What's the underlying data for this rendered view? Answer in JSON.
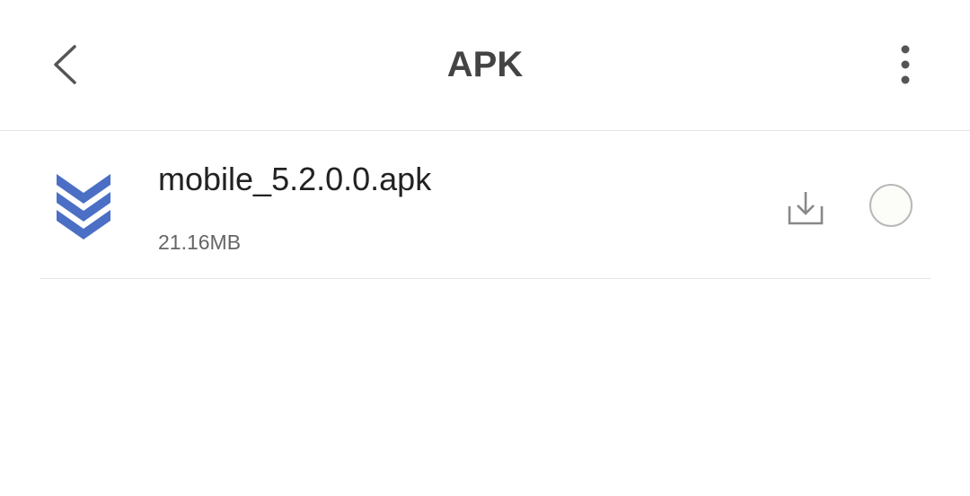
{
  "header": {
    "title": "APK",
    "back_icon": "chevron-left-icon",
    "more_icon": "more-vertical-icon"
  },
  "files": [
    {
      "name": "mobile_5.2.0.0.apk",
      "size": "21.16MB",
      "icon": "triple-chevron-down-icon",
      "action_icon": "download-icon",
      "selected": false
    }
  ],
  "colors": {
    "background": "#ffffff",
    "title_text": "#444444",
    "file_name_text": "#222222",
    "file_size_text": "#666666",
    "icon_gray": "#888888",
    "app_icon_blue": "#4a6fc4",
    "divider": "#e3e3e3",
    "radio_border": "#b8b8b8"
  }
}
